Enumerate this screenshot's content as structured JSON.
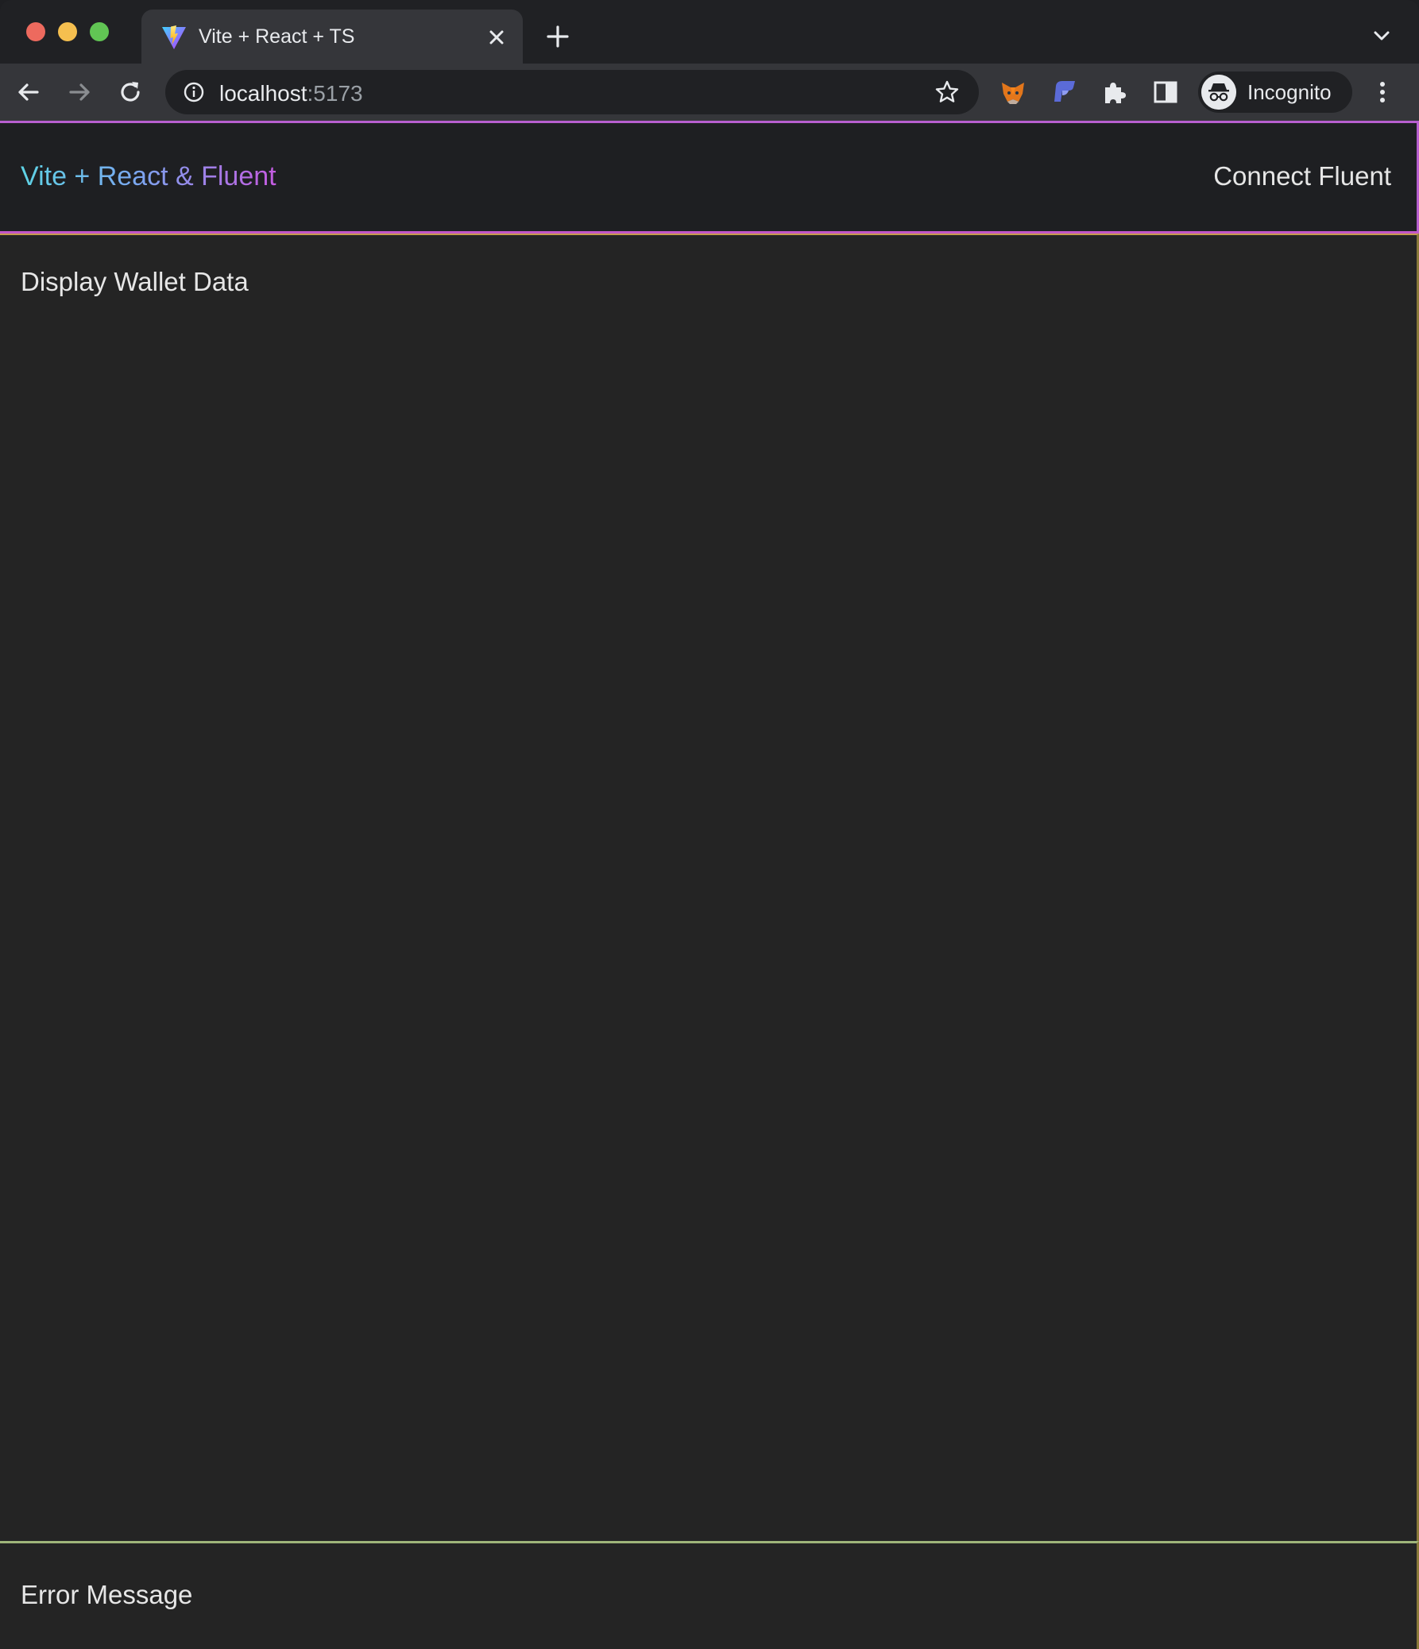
{
  "browser": {
    "tab": {
      "title": "Vite + React + TS",
      "favicon": "vite-logo-icon"
    },
    "address_bar": {
      "host": "localhost",
      "port": ":5173"
    },
    "profile": {
      "label": "Incognito"
    },
    "icons": {
      "back": "arrow-left-icon",
      "forward": "arrow-right-icon",
      "reload": "reload-icon",
      "info": "info-icon",
      "bookmark": "star-icon",
      "extensions": [
        "metamask-fox-icon",
        "fluent-wallet-icon",
        "puzzle-icon",
        "side-panel-icon"
      ],
      "menu": "kebab-menu-icon"
    }
  },
  "app": {
    "header": {
      "brand": "Vite + React & Fluent",
      "connect_label": "Connect Fluent"
    },
    "main": {
      "title": "Display Wallet Data"
    },
    "error": {
      "title": "Error Message"
    }
  },
  "colors": {
    "header_border": "#c356c9",
    "main_border": "#c79b4e",
    "error_border": "#9fb57a",
    "brand_gradient_start": "#5ed3e5",
    "brand_gradient_end": "#c45be0"
  }
}
